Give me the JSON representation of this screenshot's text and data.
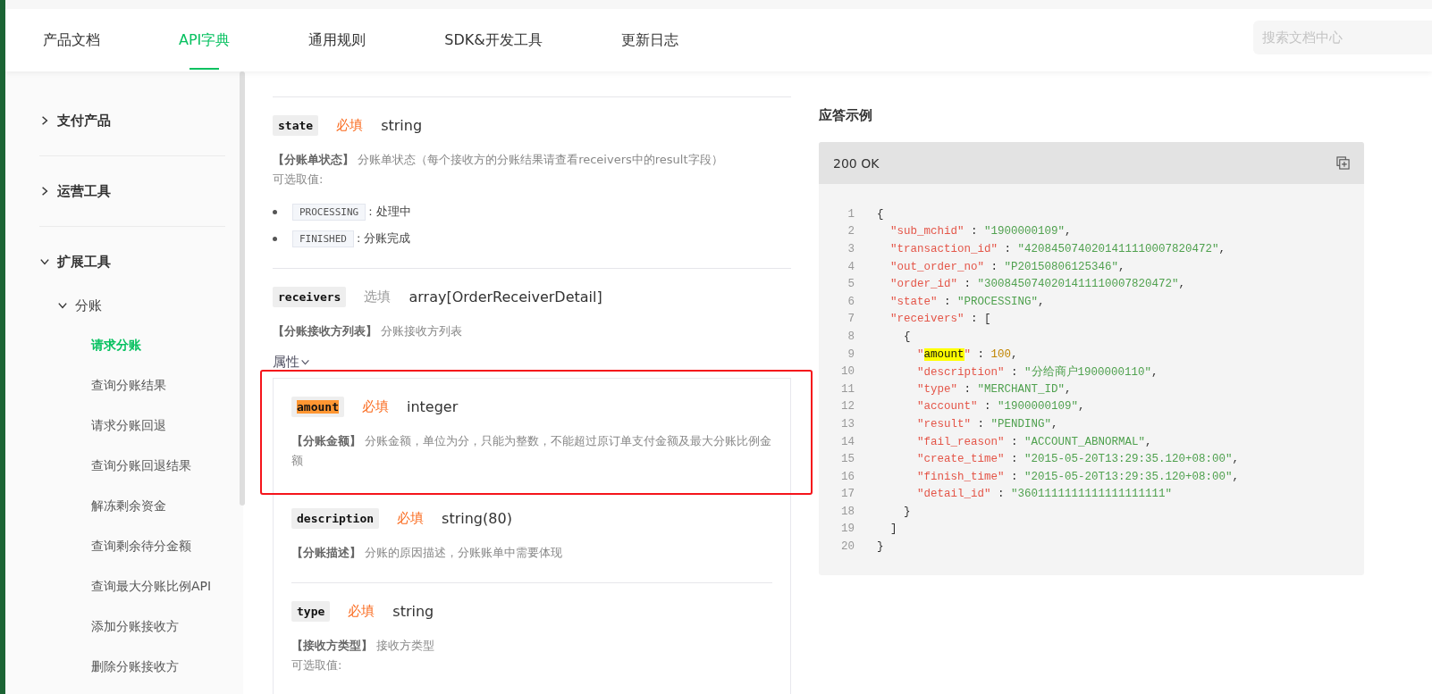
{
  "nav": {
    "tabs": [
      {
        "label": "产品文档",
        "selected": false
      },
      {
        "label": "API字典",
        "selected": true
      },
      {
        "label": "通用规则",
        "selected": false
      },
      {
        "label": "SDK&开发工具",
        "selected": false
      },
      {
        "label": "更新日志",
        "selected": false
      }
    ],
    "search": {
      "placeholder": "搜索文档中心"
    }
  },
  "sidebar": {
    "items": [
      {
        "label": "支付产品",
        "expanded": false
      },
      {
        "label": "运营工具",
        "expanded": false
      },
      {
        "label": "扩展工具",
        "expanded": true,
        "children": [
          {
            "label": "分账",
            "expanded": true,
            "children": [
              {
                "label": "请求分账",
                "selected": true
              },
              {
                "label": "查询分账结果",
                "selected": false
              },
              {
                "label": "请求分账回退",
                "selected": false
              },
              {
                "label": "查询分账回退结果",
                "selected": false
              },
              {
                "label": "解冻剩余资金",
                "selected": false
              },
              {
                "label": "查询剩余待分金额",
                "selected": false
              },
              {
                "label": "查询最大分账比例API",
                "selected": false
              },
              {
                "label": "添加分账接收方",
                "selected": false
              },
              {
                "label": "删除分账接收方",
                "selected": false
              }
            ]
          }
        ]
      }
    ]
  },
  "params": [
    {
      "name": "state",
      "required": true,
      "required_label": "必填",
      "type": "string",
      "desc_title": "【分账单状态】",
      "desc": "分账单状态（每个接收方的分账结果请查看receivers中的result字段）",
      "options_label": "可选取值:",
      "options": [
        {
          "code": "PROCESSING",
          "label": ": 处理中"
        },
        {
          "code": "FINISHED",
          "label": ": 分账完成"
        }
      ]
    },
    {
      "name": "receivers",
      "required": false,
      "required_label": "选填",
      "type": "array[OrderReceiverDetail]",
      "desc_title": "【分账接收方列表】",
      "desc": "分账接收方列表",
      "attributes": {
        "label": "属性",
        "expanded": true,
        "children": [
          {
            "name": "amount",
            "highlighted": true,
            "required": true,
            "required_label": "必填",
            "type": "integer",
            "desc_title": "【分账金额】",
            "desc": "分账金额，单位为分，只能为整数，不能超过原订单支付金额及最大分账比例金额"
          },
          {
            "name": "description",
            "highlighted": false,
            "required": true,
            "required_label": "必填",
            "type": "string(80)",
            "desc_title": "【分账描述】",
            "desc": "分账的原因描述，分账账单中需要体现"
          },
          {
            "name": "type",
            "highlighted": false,
            "required": true,
            "required_label": "必填",
            "type": "string",
            "desc_title": "【接收方类型】",
            "desc": "接收方类型",
            "options_label": "可选取值:"
          }
        ]
      }
    }
  ],
  "response": {
    "title": "应答示例",
    "status": "200 OK",
    "lines": [
      {
        "n": "1",
        "tokens": [
          {
            "kind": "punct",
            "text": "{"
          }
        ]
      },
      {
        "n": "2",
        "tokens": [
          {
            "kind": "key",
            "text": "  \"sub_mchid\""
          },
          {
            "kind": "punct",
            "text": " : "
          },
          {
            "kind": "str",
            "text": "\"1900000109\""
          },
          {
            "kind": "punct",
            "text": ","
          }
        ]
      },
      {
        "n": "3",
        "tokens": [
          {
            "kind": "key",
            "text": "  \"transaction_id\""
          },
          {
            "kind": "punct",
            "text": " : "
          },
          {
            "kind": "str",
            "text": "\"4208450740201411110007820472\""
          },
          {
            "kind": "punct",
            "text": ","
          }
        ]
      },
      {
        "n": "4",
        "tokens": [
          {
            "kind": "key",
            "text": "  \"out_order_no\""
          },
          {
            "kind": "punct",
            "text": " : "
          },
          {
            "kind": "str",
            "text": "\"P20150806125346\""
          },
          {
            "kind": "punct",
            "text": ","
          }
        ]
      },
      {
        "n": "5",
        "tokens": [
          {
            "kind": "key",
            "text": "  \"order_id\""
          },
          {
            "kind": "punct",
            "text": " : "
          },
          {
            "kind": "str",
            "text": "\"3008450740201411110007820472\""
          },
          {
            "kind": "punct",
            "text": ","
          }
        ]
      },
      {
        "n": "6",
        "tokens": [
          {
            "kind": "key",
            "text": "  \"state\""
          },
          {
            "kind": "punct",
            "text": " : "
          },
          {
            "kind": "str",
            "text": "\"PROCESSING\""
          },
          {
            "kind": "punct",
            "text": ","
          }
        ]
      },
      {
        "n": "7",
        "tokens": [
          {
            "kind": "key",
            "text": "  \"receivers\""
          },
          {
            "kind": "punct",
            "text": " : ["
          }
        ]
      },
      {
        "n": "8",
        "tokens": [
          {
            "kind": "punct",
            "text": "    {"
          }
        ]
      },
      {
        "n": "9",
        "tokens": [
          {
            "kind": "key",
            "text": "      \""
          },
          {
            "kind": "match",
            "text": "amount"
          },
          {
            "kind": "key",
            "text": "\""
          },
          {
            "kind": "punct",
            "text": " : "
          },
          {
            "kind": "num",
            "text": "100"
          },
          {
            "kind": "punct",
            "text": ","
          }
        ]
      },
      {
        "n": "10",
        "tokens": [
          {
            "kind": "key",
            "text": "      \"description\""
          },
          {
            "kind": "punct",
            "text": " : "
          },
          {
            "kind": "str",
            "text": "\"分给商户1900000110\""
          },
          {
            "kind": "punct",
            "text": ","
          }
        ]
      },
      {
        "n": "11",
        "tokens": [
          {
            "kind": "key",
            "text": "      \"type\""
          },
          {
            "kind": "punct",
            "text": " : "
          },
          {
            "kind": "str",
            "text": "\"MERCHANT_ID\""
          },
          {
            "kind": "punct",
            "text": ","
          }
        ]
      },
      {
        "n": "12",
        "tokens": [
          {
            "kind": "key",
            "text": "      \"account\""
          },
          {
            "kind": "punct",
            "text": " : "
          },
          {
            "kind": "str",
            "text": "\"1900000109\""
          },
          {
            "kind": "punct",
            "text": ","
          }
        ]
      },
      {
        "n": "13",
        "tokens": [
          {
            "kind": "key",
            "text": "      \"result\""
          },
          {
            "kind": "punct",
            "text": " : "
          },
          {
            "kind": "str",
            "text": "\"PENDING\""
          },
          {
            "kind": "punct",
            "text": ","
          }
        ]
      },
      {
        "n": "14",
        "tokens": [
          {
            "kind": "key",
            "text": "      \"fail_reason\""
          },
          {
            "kind": "punct",
            "text": " : "
          },
          {
            "kind": "str",
            "text": "\"ACCOUNT_ABNORMAL\""
          },
          {
            "kind": "punct",
            "text": ","
          }
        ]
      },
      {
        "n": "15",
        "tokens": [
          {
            "kind": "key",
            "text": "      \"create_time\""
          },
          {
            "kind": "punct",
            "text": " : "
          },
          {
            "kind": "str",
            "text": "\"2015-05-20T13:29:35.120+08:00\""
          },
          {
            "kind": "punct",
            "text": ","
          }
        ]
      },
      {
        "n": "16",
        "tokens": [
          {
            "kind": "key",
            "text": "      \"finish_time\""
          },
          {
            "kind": "punct",
            "text": " : "
          },
          {
            "kind": "str",
            "text": "\"2015-05-20T13:29:35.120+08:00\""
          },
          {
            "kind": "punct",
            "text": ","
          }
        ]
      },
      {
        "n": "17",
        "tokens": [
          {
            "kind": "key",
            "text": "      \"detail_id\""
          },
          {
            "kind": "punct",
            "text": " : "
          },
          {
            "kind": "str",
            "text": "\"3601111111111111111111\""
          }
        ]
      },
      {
        "n": "18",
        "tokens": [
          {
            "kind": "punct",
            "text": "    }"
          }
        ]
      },
      {
        "n": "19",
        "tokens": [
          {
            "kind": "punct",
            "text": "  ]"
          }
        ]
      },
      {
        "n": "20",
        "tokens": [
          {
            "kind": "punct",
            "text": "}"
          }
        ]
      }
    ]
  }
}
